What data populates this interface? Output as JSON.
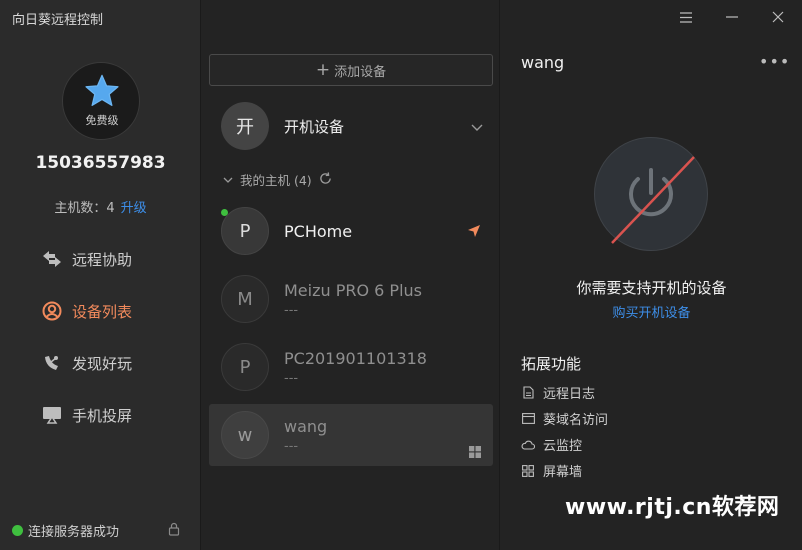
{
  "app": {
    "title": "向日葵远程控制"
  },
  "account": {
    "level": "免费级",
    "phone": "15036557983",
    "host_count_label": "主机数：",
    "host_count": "4",
    "upgrade_label": "升级"
  },
  "nav": [
    {
      "label": "远程协助",
      "icon": "remote-assist-icon",
      "active": false
    },
    {
      "label": "设备列表",
      "icon": "device-list-icon",
      "active": true
    },
    {
      "label": "发现好玩",
      "icon": "discover-icon",
      "active": false
    },
    {
      "label": "手机投屏",
      "icon": "screen-cast-icon",
      "active": false
    }
  ],
  "status": {
    "text": "连接服务器成功",
    "color": "#3fbf3f"
  },
  "middle": {
    "add_device_label": "添加设备",
    "boot_device": {
      "badge": "开",
      "label": "开机设备"
    },
    "my_hosts_label": "我的主机 (4)",
    "devices": [
      {
        "initial": "P",
        "name": "PCHome",
        "sub": "",
        "online": true
      },
      {
        "initial": "M",
        "name": "Meizu PRO 6 Plus",
        "sub": "---",
        "online": false
      },
      {
        "initial": "P",
        "name": "PC201901101318",
        "sub": "---",
        "online": false
      },
      {
        "initial": "w",
        "name": "wang",
        "sub": "---",
        "online": false,
        "selected": true
      }
    ]
  },
  "detail": {
    "title": "wang",
    "more_label": "•••",
    "need_text": "你需要支持开机的设备",
    "buy_link": "购买开机设备",
    "ext_title": "拓展功能",
    "ext_items": [
      {
        "label": "远程日志",
        "icon": "document-icon"
      },
      {
        "label": "葵域名访问",
        "icon": "browser-icon"
      },
      {
        "label": "云监控",
        "icon": "cloud-icon"
      },
      {
        "label": "屏幕墙",
        "icon": "grid-icon"
      }
    ]
  },
  "watermark": "www.rjtj.cn软荐网",
  "colors": {
    "accent": "#f28a5c",
    "link": "#3d8ee8",
    "online": "#3fbf3f",
    "power_slash": "#d9534f"
  }
}
